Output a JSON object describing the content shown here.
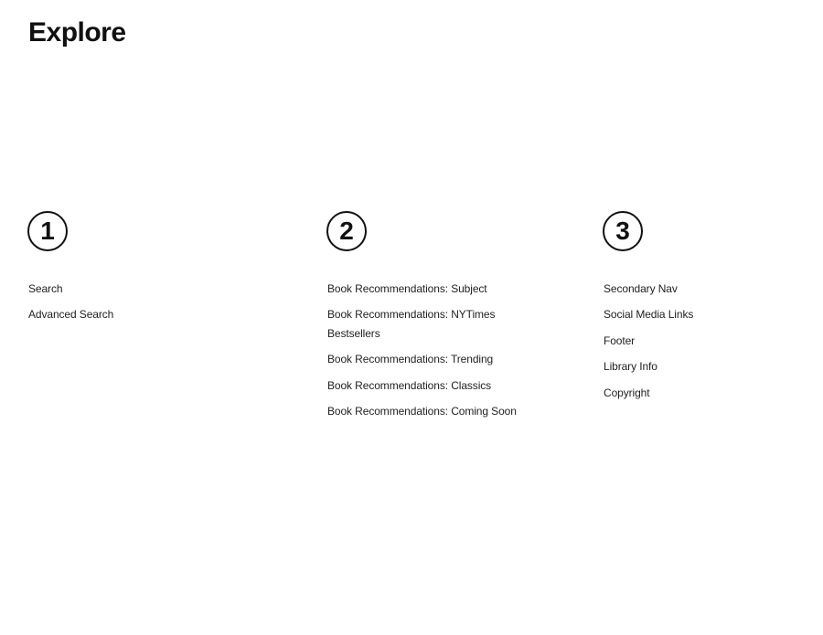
{
  "page": {
    "title": "Explore"
  },
  "columns": [
    {
      "number": "1",
      "items": [
        "Search",
        "Advanced Search"
      ]
    },
    {
      "number": "2",
      "items": [
        "Book Recommendations: Subject",
        "Book Recommendations: NYTimes Bestsellers",
        "Book Recommendations: Trending",
        "Book Recommendations: Classics",
        "Book Recommendations: Coming Soon"
      ]
    },
    {
      "number": "3",
      "items": [
        "Secondary Nav",
        "Social Media Links",
        "Footer",
        "Library Info",
        "Copyright"
      ]
    }
  ]
}
